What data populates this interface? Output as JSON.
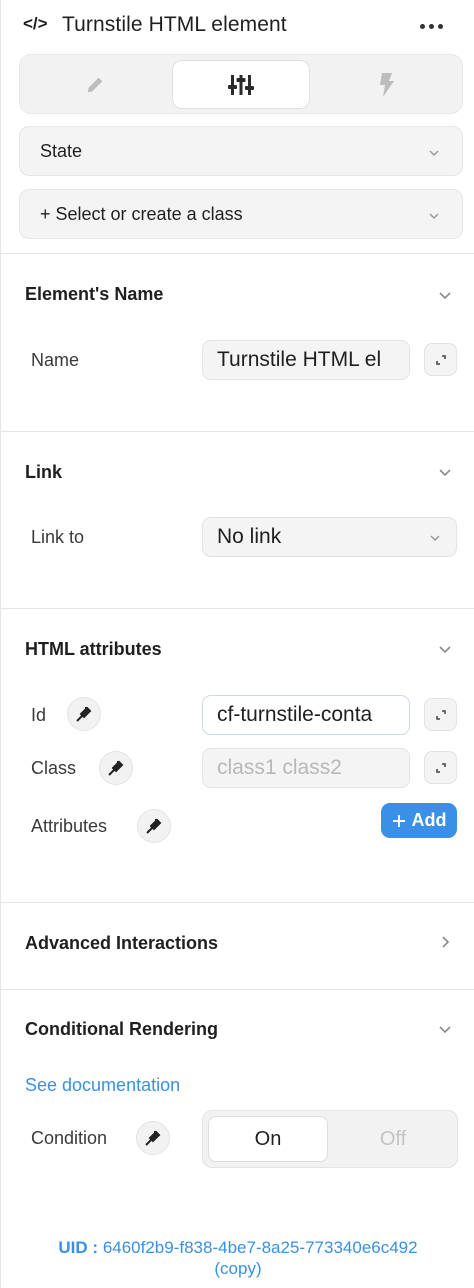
{
  "header": {
    "icon_text": "</>",
    "title": "Turnstile HTML element"
  },
  "tabs": [
    {
      "name": "style",
      "icon": "pencil-icon",
      "active": false
    },
    {
      "name": "settings",
      "icon": "sliders-icon",
      "active": true
    },
    {
      "name": "interactions",
      "icon": "lightning-icon",
      "active": false
    }
  ],
  "state_select": {
    "label": "State"
  },
  "class_select": {
    "label": "+ Select or create a class"
  },
  "element_name": {
    "title": "Element's Name",
    "name_label": "Name",
    "name_value": "Turnstile HTML el"
  },
  "link": {
    "title": "Link",
    "link_label": "Link to",
    "link_value": "No link"
  },
  "html_attributes": {
    "title": "HTML attributes",
    "id_label": "Id",
    "id_value": "cf-turnstile-conta",
    "class_label": "Class",
    "class_placeholder": "class1 class2",
    "attributes_label": "Attributes",
    "add_label": "Add"
  },
  "advanced": {
    "title": "Advanced Interactions"
  },
  "conditional": {
    "title": "Conditional Rendering",
    "doc_link": "See documentation",
    "condition_label": "Condition",
    "on_label": "On",
    "off_label": "Off"
  },
  "uid": {
    "prefix": "UID :",
    "value": "6460f2b9-f838-4be7-8a25-773340e6c492",
    "copy": "(copy)"
  },
  "colors": {
    "accent": "#3a8fe6",
    "text": "#1f1f1f",
    "muted": "#b8b8b8"
  }
}
